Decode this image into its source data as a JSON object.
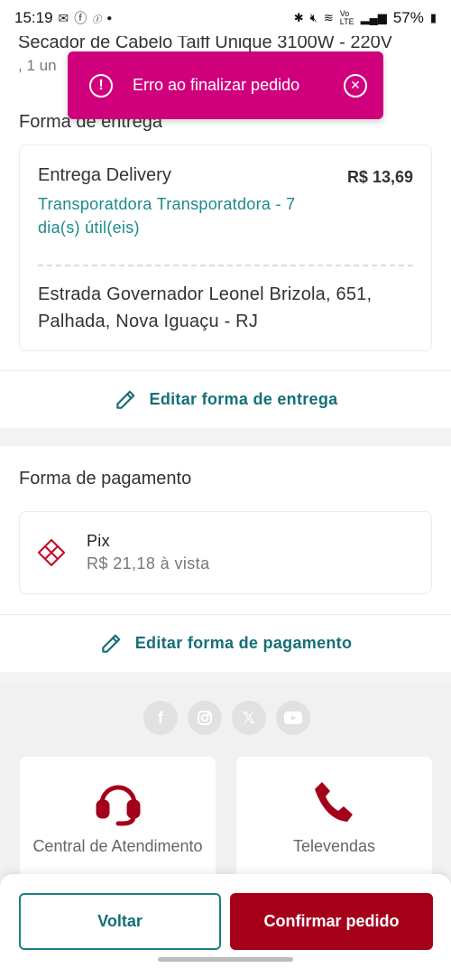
{
  "status_bar": {
    "time": "15:19",
    "battery": "57%",
    "left_icons": [
      "mail-icon",
      "facebook-icon",
      "app-icon",
      "dot-icon"
    ],
    "right_icons": [
      "bluetooth-icon",
      "mute-icon",
      "wifi-icon",
      "volte-icon",
      "signal-icon"
    ]
  },
  "product": {
    "title": "Secador de Cabelo Taiff Unique 3100W - 220V",
    "quantity": ", 1 un"
  },
  "toast": {
    "message": "Erro ao finalizar pedido",
    "color": "#d0007d"
  },
  "delivery": {
    "section_title": "Forma de entrega",
    "method": "Entrega Delivery",
    "price": "R$ 13,69",
    "carrier": "Transporatdora Transporatdora - 7 dia(s) útil(eis)",
    "address": "Estrada Governador Leonel Brizola, 651, Palhada, Nova Iguaçu - RJ",
    "edit_label": "Editar forma de entrega"
  },
  "payment": {
    "section_title": "Forma de pagamento",
    "method": "Pix",
    "amount": "R$ 21,18 à vista",
    "edit_label": "Editar forma de pagamento"
  },
  "footer": {
    "socials": [
      "facebook-icon",
      "instagram-icon",
      "x-icon",
      "youtube-icon"
    ],
    "contacts": [
      {
        "label": "Central de Atendimento",
        "icon": "headset-icon"
      },
      {
        "label": "Televendas",
        "icon": "phone-icon"
      }
    ]
  },
  "actions": {
    "back_label": "Voltar",
    "confirm_label": "Confirmar pedido"
  },
  "colors": {
    "accent": "#146f77",
    "brand": "#a4001a",
    "error": "#d0007d"
  }
}
